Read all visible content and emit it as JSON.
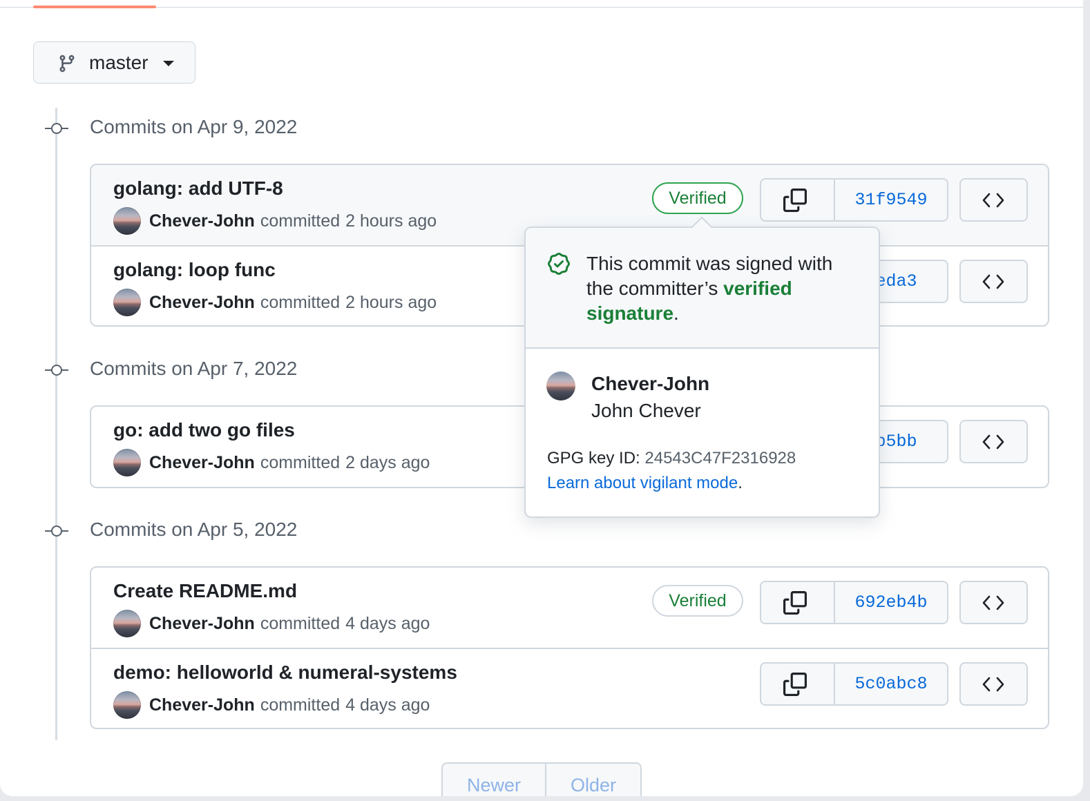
{
  "branch": {
    "name": "master"
  },
  "groups": [
    {
      "date_label": "Commits on Apr 9, 2022",
      "commits": [
        {
          "title": "golang: add UTF-8",
          "author": "Chever-John",
          "action": "committed",
          "time": "2 hours ago",
          "verified": "Verified",
          "sha": "31f9549"
        },
        {
          "title": "golang: loop func",
          "author": "Chever-John",
          "action": "committed",
          "time": "2 hours ago",
          "sha": "4eda3"
        }
      ]
    },
    {
      "date_label": "Commits on Apr 7, 2022",
      "commits": [
        {
          "title": "go: add two go files",
          "author": "Chever-John",
          "action": "committed",
          "time": "2 days ago",
          "sha": "fb5bb"
        }
      ]
    },
    {
      "date_label": "Commits on Apr 5, 2022",
      "commits": [
        {
          "title": "Create README.md",
          "author": "Chever-John",
          "action": "committed",
          "time": "4 days ago",
          "verified": "Verified",
          "sha": "692eb4b"
        },
        {
          "title": "demo: helloworld & numeral-systems",
          "author": "Chever-John",
          "action": "committed",
          "time": "4 days ago",
          "sha": "5c0abc8"
        }
      ]
    }
  ],
  "popover": {
    "message_prefix": "This commit was signed with the committer’s ",
    "message_highlight": "verified signature",
    "message_suffix": ".",
    "login": "Chever-John",
    "full_name": "John Chever",
    "gpg_label": "GPG key ID: ",
    "gpg_key_id": "24543C47F2316928",
    "learn_link": "Learn about vigilant mode",
    "learn_suffix": "."
  },
  "pagination": {
    "newer": "Newer",
    "older": "Older"
  },
  "colors": {
    "accent_tab": "#fd8c73",
    "verified_green": "#1a7f37",
    "link_blue": "#0969da"
  },
  "icons": {
    "branch": "git-branch-icon",
    "copy": "copy-icon",
    "browse": "code-icon",
    "commit": "git-commit-icon",
    "verified": "verified-check-icon"
  }
}
